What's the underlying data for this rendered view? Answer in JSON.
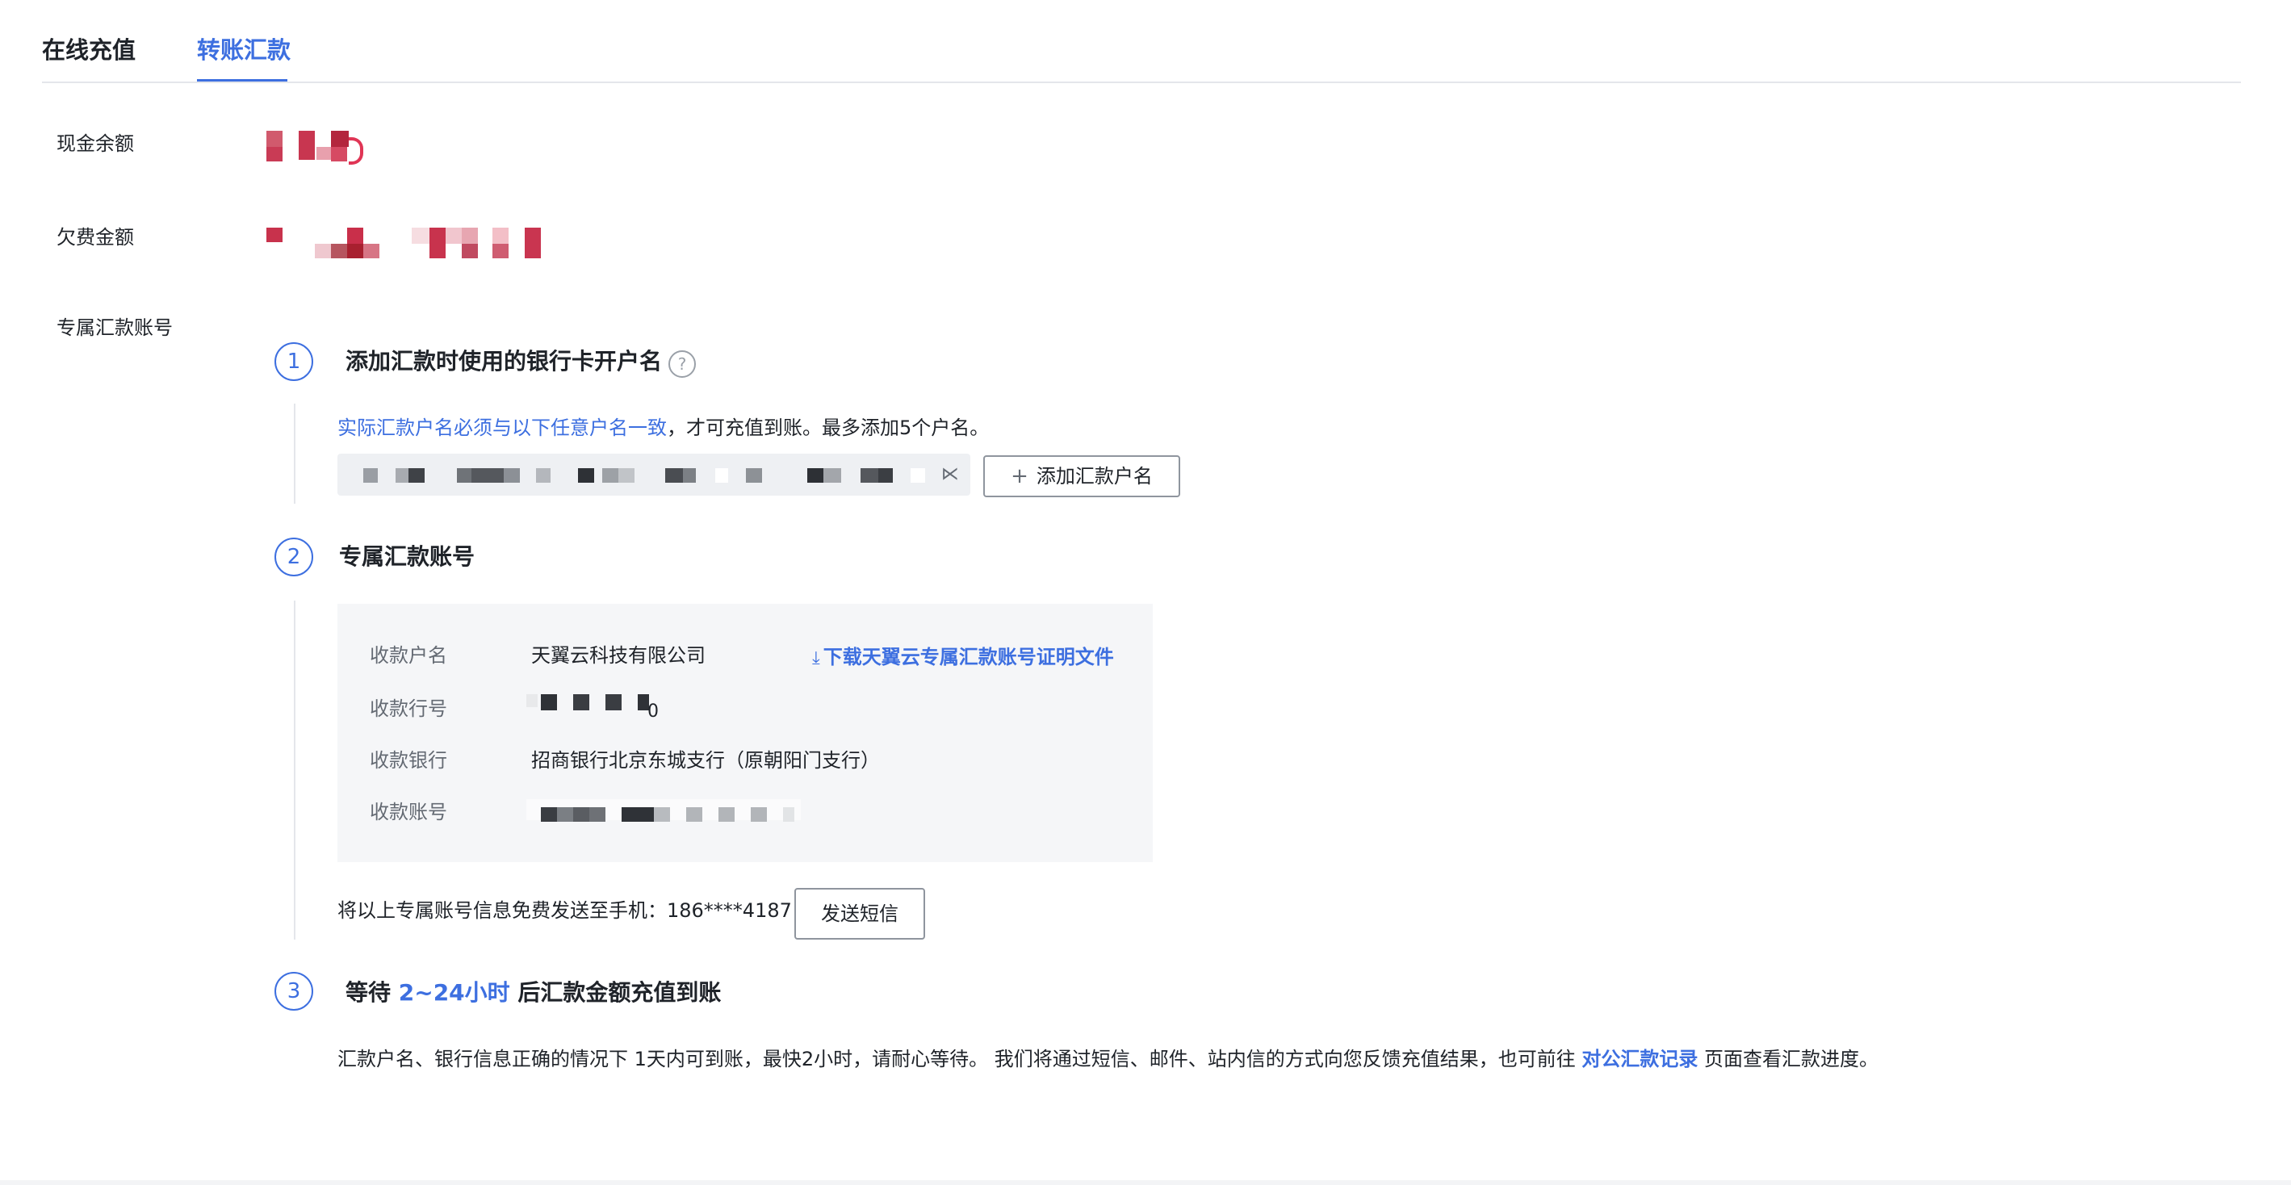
{
  "tabs": [
    {
      "label": "在线充值",
      "active": false
    },
    {
      "label": "转账汇款",
      "active": true
    }
  ],
  "accent_color": "#3d6fe0",
  "balance": {
    "cash_label": "现金余额",
    "arrears_label": "欠费金额",
    "dedicated_account_label": "专属汇款账号"
  },
  "step1": {
    "number": "1",
    "title": "添加汇款时使用的银行卡开户名",
    "help_icon": "question-circle-icon",
    "notice_link": "实际汇款户名必须与以下任意户名一致",
    "notice_rest": "，才可充值到账。最多添加5个户名。",
    "add_button": "添加汇款户名"
  },
  "step2": {
    "number": "2",
    "title": "专属汇款账号",
    "payee_name_label": "收款户名",
    "payee_name_value": "天翼云科技有限公司",
    "download_link": "下载天翼云专属汇款账号证明文件",
    "bank_code_label": "收款行号",
    "bank_code_suffix": "0",
    "bank_label": "收款银行",
    "bank_value": "招商银行北京东城支行（原朝阳门支行）",
    "account_label": "收款账号",
    "sms_text": "将以上专属账号信息免费发送至手机：186****4187",
    "sms_button": "发送短信"
  },
  "step3": {
    "number": "3",
    "title_prefix": "等待 ",
    "title_highlight": "2~24小时",
    "title_suffix": " 后汇款金额充值到账",
    "desc_prefix": "汇款户名、银行信息正确的情况下 1天内可到账，最快2小时，请耐心等待。 我们将通过短信、邮件、站内信的方式向您反馈充值结果，也可前往 ",
    "desc_link": "对公汇款记录",
    "desc_suffix": " 页面查看汇款进度。"
  }
}
